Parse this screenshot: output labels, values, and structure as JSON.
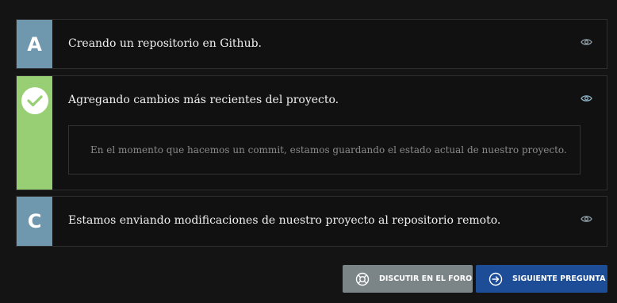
{
  "options": [
    {
      "badge": "A",
      "text": "Creando un repositorio en Github."
    },
    {
      "badge": "",
      "text": "Agregando cambios más recientes del proyecto.",
      "explanation": "En el momento que hacemos un commit, estamos guardando el estado actual de nuestro proyecto."
    },
    {
      "badge": "C",
      "text": "Estamos enviando modificaciones de nuestro proyecto al repositorio remoto."
    }
  ],
  "buttons": {
    "forum": "DISCUTIR EN EL FORO",
    "next": "SIGUIENTE PREGUNTA"
  },
  "icons": {
    "correct": "check-icon",
    "show": "eye-icon",
    "forum": "lifebuoy-icon",
    "next": "arrow-right-circle-icon"
  },
  "colors": {
    "letter_badge": "#6f97ae",
    "correct_badge": "#98cf74",
    "forum_button": "#7b8588",
    "next_button": "#1e4d98"
  }
}
